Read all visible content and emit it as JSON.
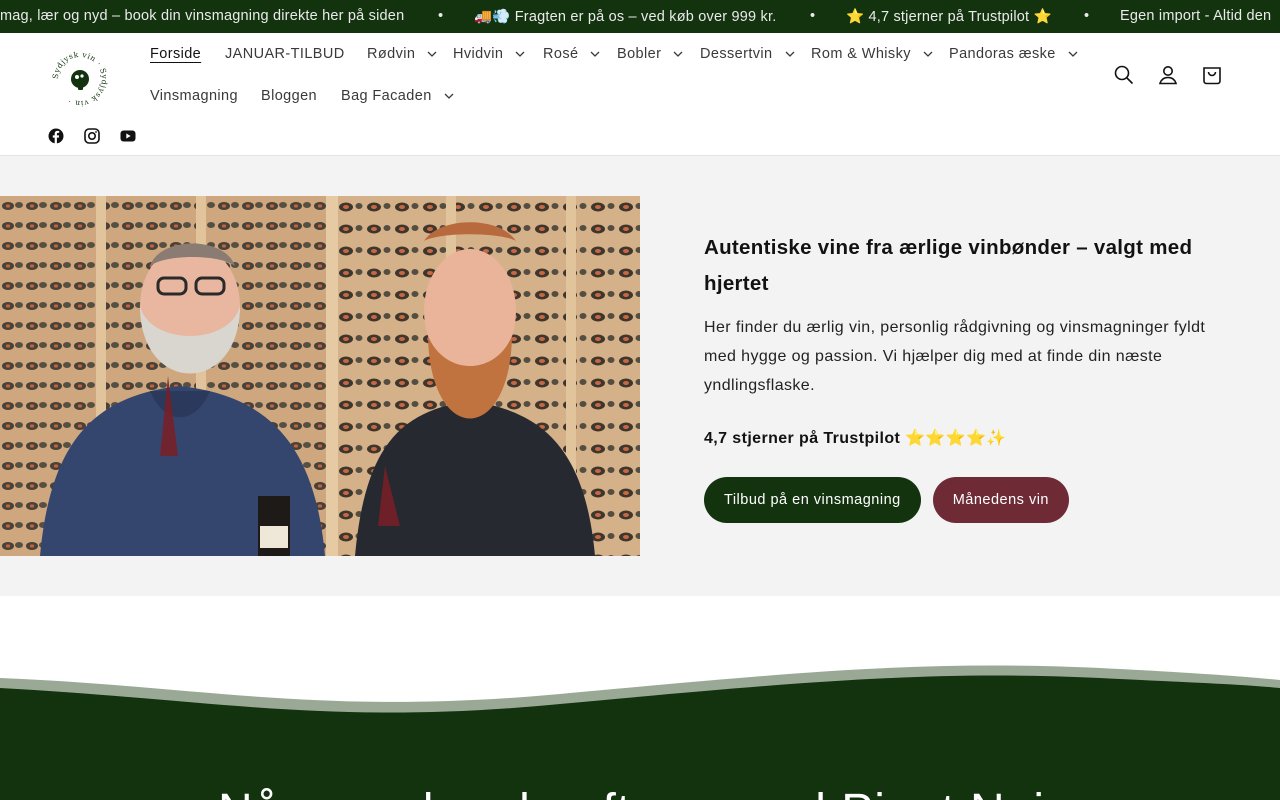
{
  "announcement": {
    "items": [
      "mag, lær og nyd – book din vinsmagning direkte her på siden",
      "🚚💨 Fragten er på os – ved køb over 999 kr.",
      "⭐ 4,7 stjerner på Trustpilot ⭐",
      "Egen import - Altid den"
    ],
    "separator": "•"
  },
  "header": {
    "logo_alt": "Sydjysk vin",
    "nav": [
      {
        "label": "Forside"
      },
      {
        "label": "JANUAR-TILBUD"
      },
      {
        "label": "Rødvin"
      },
      {
        "label": "Hvidvin"
      },
      {
        "label": "Rosé"
      },
      {
        "label": "Bobler"
      },
      {
        "label": "Dessertvin"
      },
      {
        "label": "Rom & Whisky"
      },
      {
        "label": "Pandoras æske"
      },
      {
        "label": "Vinsmagning"
      },
      {
        "label": "Bloggen"
      },
      {
        "label": "Bag Facaden"
      }
    ],
    "icons": [
      "search-icon",
      "account-icon",
      "cart-icon"
    ],
    "social": [
      "facebook-icon",
      "instagram-icon",
      "youtube-icon"
    ]
  },
  "hero": {
    "title": "Autentiske vine fra ærlige vinbønder – valgt med hjertet",
    "body": "Her finder du ærlig vin, personlig rådgivning og vinsmagninger fyldt med hygge og passion. Vi hjælper dig med at finde din næste yndlingsflaske.",
    "rating": "4,7 stjerner på Trustpilot ⭐⭐⭐⭐✨",
    "button_primary": "Tilbud på en vinsmagning",
    "button_secondary": "Månedens vin"
  },
  "section": {
    "heading": "Nå ... og hvad ... fta ... med Pinot Noir"
  },
  "colors": {
    "brand_green": "#13330f",
    "wine_red": "#6e2b36",
    "hero_bg": "#f3f3f3"
  }
}
